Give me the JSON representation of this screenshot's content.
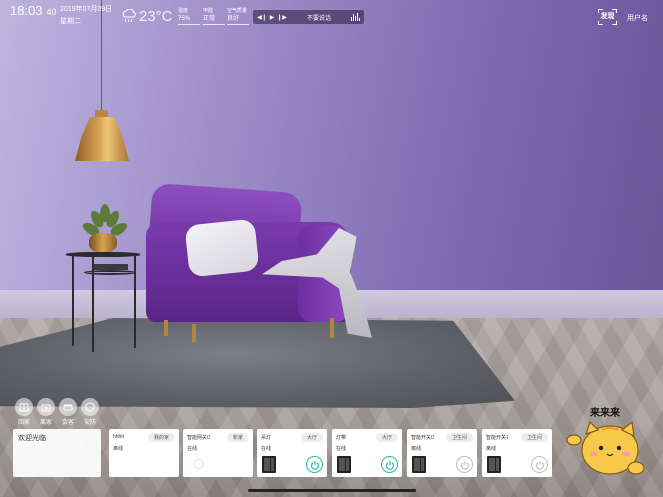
{
  "header": {
    "time": "18:03",
    "seconds": "40",
    "date": "2019年07月09日",
    "weekday": "星期二",
    "weather_icon": "cloud-rain-icon",
    "temperature": "23°C",
    "stats": [
      {
        "label": "湿度",
        "value": "75%"
      },
      {
        "label": "甲醛",
        "value": "正常"
      },
      {
        "label": "空气质量",
        "value": "良好"
      }
    ],
    "player": {
      "prev_icon": "skip-back-icon",
      "play_icon": "play-icon",
      "next_icon": "skip-forward-icon",
      "text": "不要说话",
      "eq_icon": "equalizer-icon"
    },
    "discover_label": "发现",
    "username": "用户名"
  },
  "modes": [
    {
      "label": "回家",
      "icon": "home-icon"
    },
    {
      "label": "离家",
      "icon": "leave-icon"
    },
    {
      "label": "会客",
      "icon": "sofa-icon"
    },
    {
      "label": "安防",
      "icon": "shield-icon"
    }
  ],
  "welcome": {
    "text": "欢迎光临"
  },
  "devices": [
    {
      "name": "hhhh",
      "room": "我的家",
      "status": "离线",
      "type": "blank",
      "power": "none"
    },
    {
      "name": "智能网关0",
      "room": "新家",
      "status": "在线",
      "type": "gateway",
      "power": "none"
    },
    {
      "name": "吊灯",
      "room": "大厅",
      "status": "在线",
      "type": "switch",
      "power": "on"
    },
    {
      "name": "灯带",
      "room": "大厅",
      "status": "在线",
      "type": "switch",
      "power": "on"
    },
    {
      "name": "智能开关0",
      "room": "卫生间",
      "status": "离线",
      "type": "switch",
      "power": "off"
    },
    {
      "name": "智能开关1",
      "room": "卫生间",
      "status": "离线",
      "type": "switch",
      "power": "off"
    }
  ],
  "mascot": {
    "text": "来来来",
    "icon": "cat-mascot-icon"
  },
  "colors": {
    "accent_on": "#27b8a0",
    "off": "#c0c0c0",
    "sofa": "#6c2f9c",
    "wall": "#8a78bd"
  }
}
